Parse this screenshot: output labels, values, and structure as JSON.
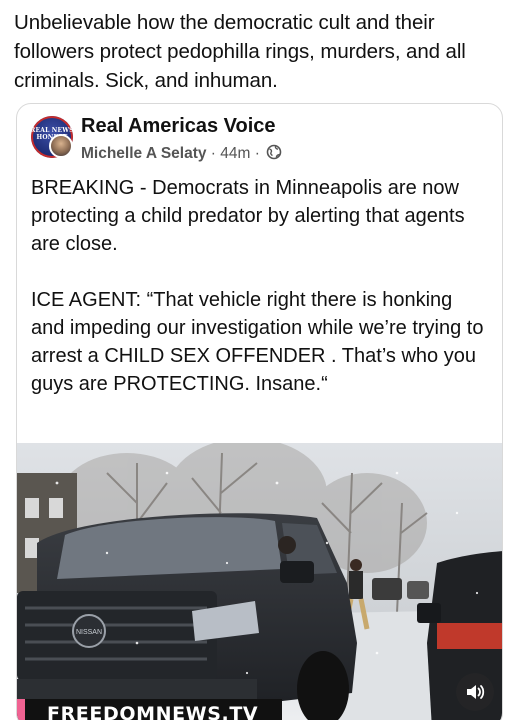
{
  "outer_post": {
    "text": "Unbelievable how the democratic cult and their followers protect pedophilla rings, murders, and all criminals. Sick, and inhuman."
  },
  "shared_post": {
    "page_name": "Real Americas Voice",
    "avatar_text": "REAL NEWS HONEST",
    "author": "Michelle A Selaty",
    "time": "44m",
    "separator": "·",
    "privacy_icon": "globe-icon",
    "paragraphs": [
      "BREAKING - Democrats in Minneapolis are now protecting a child predator by alerting that agents are close.",
      "ICE AGENT: “That vehicle right there is honking and impeding our investigation while we’re trying to arrest a CHILD SEX OFFENDER . That’s who you guys are PROTECTING. Insane.“"
    ],
    "video": {
      "watermark": "FREEDOMNEWS.TV",
      "watermark_accent": "#f06292",
      "truck_badge": "NISSAN",
      "sound_icon": "speaker-icon"
    }
  }
}
